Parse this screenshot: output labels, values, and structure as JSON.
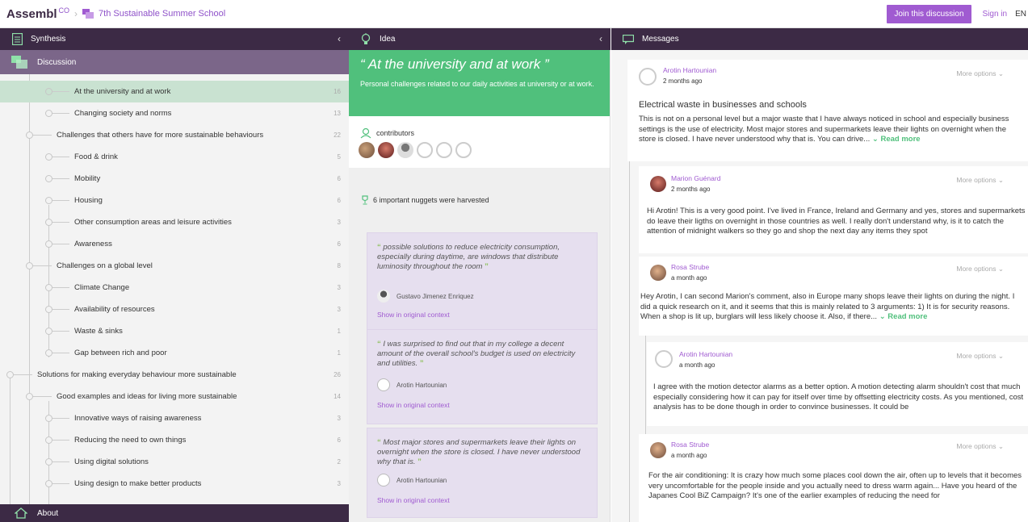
{
  "topbar": {
    "logo": "Assembl",
    "logo_sup": "CO",
    "separator": "›",
    "breadcrumb": "7th Sustainable Summer School",
    "join_label": "Join this discussion",
    "signin_label": "Sign in",
    "lang_label": "EN"
  },
  "panels": {
    "synthesis_title": "Synthesis",
    "idea_title": "Idea",
    "messages_title": "Messages",
    "collapse": "‹"
  },
  "sidebar": {
    "discussion_label": "Discussion",
    "about_label": "About",
    "items": [
      {
        "label": "At the university and at work",
        "count": "16"
      },
      {
        "label": "Changing society and norms",
        "count": "13"
      },
      {
        "label": "Challenges that others have for more sustainable behaviours",
        "count": "22"
      },
      {
        "label": "Food & drink",
        "count": "5"
      },
      {
        "label": "Mobility",
        "count": "6"
      },
      {
        "label": "Housing",
        "count": "6"
      },
      {
        "label": "Other consumption areas and leisure activities",
        "count": "3"
      },
      {
        "label": "Awareness",
        "count": "6"
      },
      {
        "label": "Challenges on a global level",
        "count": "8"
      },
      {
        "label": "Climate Change",
        "count": "3"
      },
      {
        "label": "Availability of resources",
        "count": "3"
      },
      {
        "label": "Waste & sinks",
        "count": "1"
      },
      {
        "label": "Gap between rich and poor",
        "count": "1"
      },
      {
        "label": "Solutions for making everyday behaviour more sustainable",
        "count": "26"
      },
      {
        "label": "Good examples and ideas for living more sustainable",
        "count": "14"
      },
      {
        "label": "Innovative ways of raising awareness",
        "count": "3"
      },
      {
        "label": "Reducing the need to own things",
        "count": "6"
      },
      {
        "label": "Using digital solutions",
        "count": "2"
      },
      {
        "label": "Using design to make better products",
        "count": "3"
      }
    ]
  },
  "idea": {
    "title": "At the university and at work",
    "subtitle": "Personal challenges related to our daily activities at university or at work.",
    "contributors_label": "contributors",
    "nuggets_label": "6 important nuggets were harvested",
    "show_context": "Show in original context",
    "nuggets": [
      {
        "text": "possible solutions to reduce electricity consumption, especially during daytime, are windows that distribute luminosity throughout the room",
        "author": "Gustavo Jimenez Enriquez"
      },
      {
        "text": "I was surprised to find out that in my college a decent amount of the overall school's budget is used on electricity and utilities.",
        "author": "Arotin Hartounian"
      },
      {
        "text": "Most major stores and supermarkets leave their lights on overnight when the store is closed. I have never understood why that is.",
        "author": "Arotin Hartounian"
      }
    ]
  },
  "messages": {
    "more_options": "More options",
    "read_more": "Read more",
    "items": [
      {
        "author": "Arotin Hartounian",
        "time": "2 months ago",
        "subject": "Electrical waste in businesses and schools",
        "body": "This is not on a personal level but a major waste that I have always noticed in school and especially business settings is the use of electricity. Most major stores and supermarkets leave their lights on overnight when the store is closed. I have never understood why that is. You can drive..."
      },
      {
        "author": "Marion Guénard",
        "time": "2 months ago",
        "body": "Hi Arotin! This is a very good point. I've lived in France, Ireland and Germany and yes, stores and supermarkets do leave their ligths on overnight in those countries as well. I really don't understand why, is it to catch the attention of midnight walkers so they go and shop the next day any items they spot"
      },
      {
        "author": "Rosa Strube",
        "time": "a month ago",
        "body": "Hey Arotin, I can second Marion's comment, also in Europe many shops leave their lights on during the night. I did a quick research on it, and it seems that this is mainly related to 3 arguments: 1) It is for security reasons. When a shop is lit up, burglars will less likely choose it. Also, if there..."
      },
      {
        "author": "Arotin Hartounian",
        "time": "a month ago",
        "body": "I agree with the motion detector alarms as a better option. A motion detecting alarm shouldn't cost that much especially considering how it can pay for itself over time by offsetting electricity costs. As you mentioned, cost analysis has to be done though in order to convince businesses. It could be"
      },
      {
        "author": "Rosa Strube",
        "time": "a month ago",
        "body": "For the air conditioning: It is crazy how much some places cool down the air, often up to levels that it becomes very uncomfortable for the people inside and you actually need to dress warm again... Have you heard of the Japanes Cool BiZ Campaign? It's one of the earlier examples of reducing the need for"
      }
    ]
  },
  "colors": {
    "header": "#3c2a45",
    "accent": "#a05bd1",
    "idea_green": "#50c07c",
    "selected": "#c9e2d1",
    "discussion": "#7b6689"
  }
}
